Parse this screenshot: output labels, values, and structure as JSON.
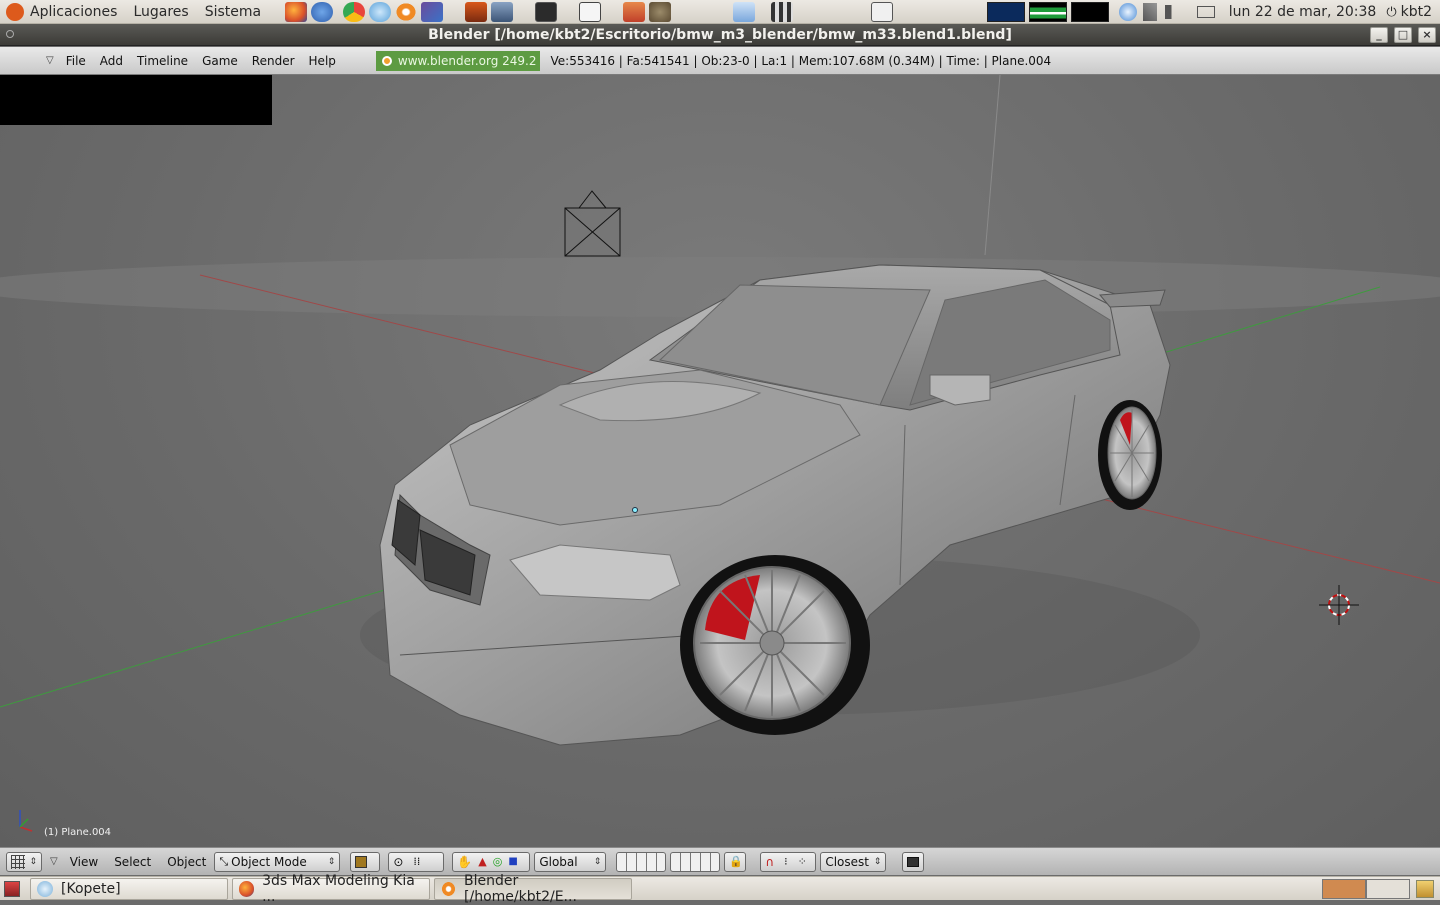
{
  "top_panel": {
    "menus": [
      "Aplicaciones",
      "Lugares",
      "Sistema"
    ],
    "launchers": [
      "firefox-icon",
      "help-icon",
      "chrome-icon",
      "kopete-icon",
      "blender-icon",
      "inkscape-icon",
      "app-icon",
      "installer-icon",
      "terminal-icon",
      "monitor-icon",
      "notes-icon",
      "gimp-icon",
      "download-icon",
      "clapper-icon",
      "screenshot-icon"
    ],
    "clock": "lun 22 de mar, 20:38",
    "user": "kbt2"
  },
  "window": {
    "title": "Blender [/home/kbt2/Escritorio/bmw_m3_blender/bmw_m33.blend1.blend]",
    "buttons": [
      "_",
      "□",
      "×"
    ]
  },
  "info_header": {
    "menus": [
      "File",
      "Add",
      "Timeline",
      "Game",
      "Render",
      "Help"
    ],
    "splash_link": "www.blender.org 249.2",
    "stats": "Ve:553416 | Fa:541541 | Ob:23-0 | La:1  | Mem:107.68M (0.34M)  | Time: | Plane.004"
  },
  "viewport": {
    "object_label": "(1) Plane.004"
  },
  "view_header": {
    "menus": [
      "View",
      "Select",
      "Object"
    ],
    "mode": "Object Mode",
    "orientation": "Global",
    "snap_target": "Closest"
  },
  "taskbar": {
    "tasks": [
      {
        "label": "[Kopete]",
        "active": false
      },
      {
        "label": "3ds Max Modeling Kia ...",
        "active": false
      },
      {
        "label": "Blender [/home/kbt2/E...",
        "active": true
      }
    ]
  },
  "colors": {
    "panel": "#dcd8cf",
    "titlebar": "#3c3b37",
    "viewport": "#6b6b6b",
    "caliper": "#c0141c"
  }
}
